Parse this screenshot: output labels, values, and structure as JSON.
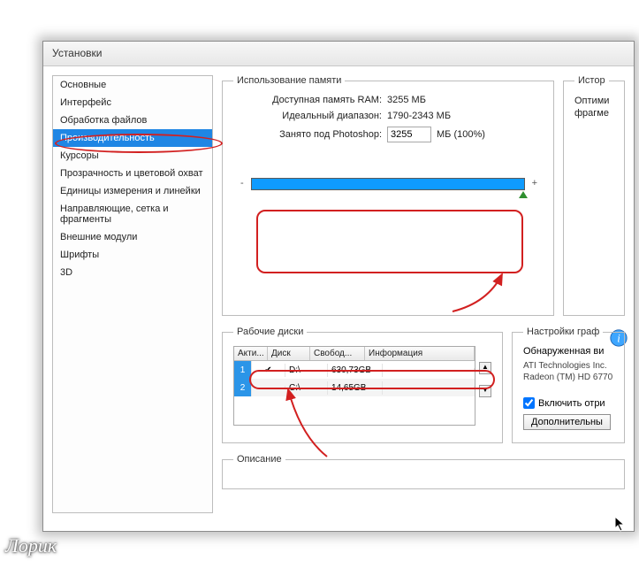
{
  "window": {
    "title": "Установки"
  },
  "sidebar": {
    "selected_index": 3,
    "items": [
      "Основные",
      "Интерфейс",
      "Обработка файлов",
      "Производительность",
      "Курсоры",
      "Прозрачность и цветовой охват",
      "Единицы измерения и линейки",
      "Направляющие, сетка и фрагменты",
      "Внешние модули",
      "Шрифты",
      "3D"
    ]
  },
  "memory": {
    "legend": "Использование памяти",
    "available_label": "Доступная память RAM:",
    "available_value": "3255 МБ",
    "ideal_label": "Идеальный диапазон:",
    "ideal_value": "1790-2343 МБ",
    "used_label": "Занято под Photoshop:",
    "used_value": "3255",
    "used_unit": "МБ (100%)",
    "slider_minus": "-",
    "slider_plus": "+",
    "slider_percent": 100
  },
  "scratch": {
    "legend": "Рабочие диски",
    "columns": {
      "num": "",
      "active": "Акти...",
      "disk": "Диск",
      "free": "Свобод...",
      "info": "Информация"
    },
    "rows": [
      {
        "num": "1",
        "active": true,
        "disk": "D:\\",
        "free": "630,73GB",
        "info": ""
      },
      {
        "num": "2",
        "active": false,
        "disk": "C:\\",
        "free": "14,65GB",
        "info": ""
      }
    ]
  },
  "history": {
    "legend": "Истор",
    "line1": "Оптими",
    "line2": "фрагме"
  },
  "graphics": {
    "legend": "Настройки граф",
    "detected_label": "Обнаруженная ви",
    "card_line1": "ATI Technologies Inc.",
    "card_line2": "Radeon (TM) HD 6770",
    "enable_label": "Включить отри",
    "advanced_btn": "Дополнительны"
  },
  "description": {
    "legend": "Описание"
  },
  "watermark": "Лорик"
}
